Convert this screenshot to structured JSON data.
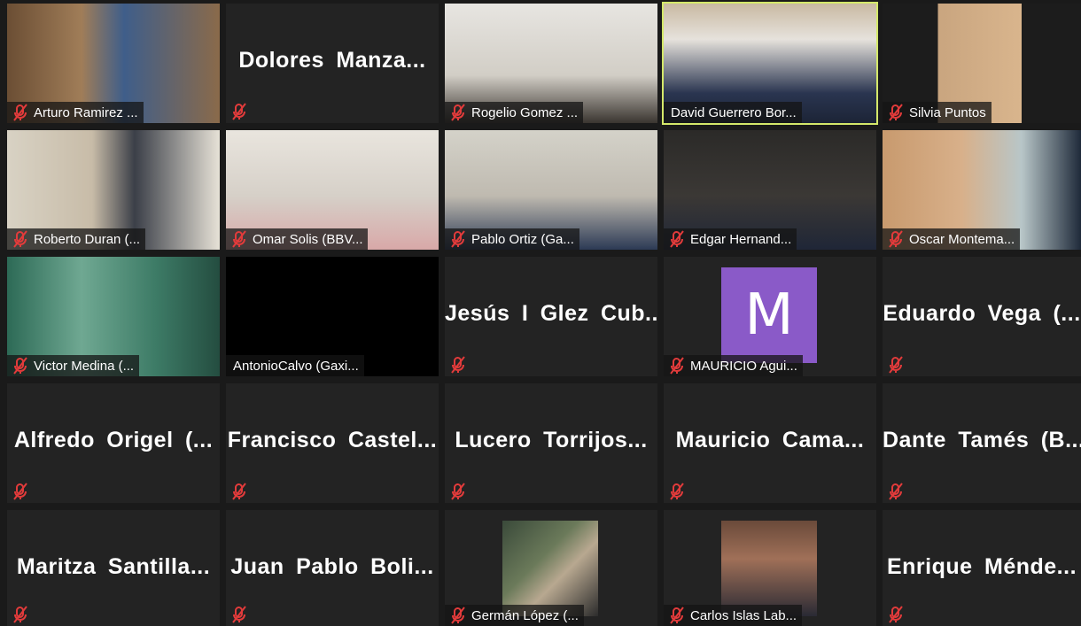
{
  "colors": {
    "mute_icon": "#e23b3b",
    "active_speaker_border": "#d4e86a",
    "avatar_m_bg": "#8a5ac8"
  },
  "participants": [
    {
      "name": "Arturo Ramirez ...",
      "display": "video",
      "muted": true
    },
    {
      "name": "Dolores  Manza...",
      "display": "name",
      "muted": true
    },
    {
      "name": "Rogelio Gomez ...",
      "display": "video",
      "muted": true
    },
    {
      "name": "David Guerrero Bor...",
      "display": "video",
      "muted": false,
      "active": true
    },
    {
      "name": "Silvia Puntos",
      "display": "video",
      "muted": true
    },
    {
      "name": "Roberto Duran (...",
      "display": "video",
      "muted": true
    },
    {
      "name": "Omar Solis (BBV...",
      "display": "video",
      "muted": true
    },
    {
      "name": "Pablo Ortiz  (Ga...",
      "display": "video",
      "muted": true
    },
    {
      "name": "Edgar Hernand...",
      "display": "video",
      "muted": true
    },
    {
      "name": "Oscar Montema...",
      "display": "video",
      "muted": true
    },
    {
      "name": "Victor Medina (...",
      "display": "video",
      "muted": true
    },
    {
      "name": "AntonioCalvo (Gaxi...",
      "display": "video",
      "muted": false
    },
    {
      "name": "Jesús I Glez Cub...",
      "display": "name",
      "muted": true
    },
    {
      "name": "MAURICIO Agui...",
      "display": "avatar",
      "avatar_letter": "M",
      "muted": true
    },
    {
      "name": "Eduardo  Vega  (...",
      "display": "name",
      "muted": true
    },
    {
      "name": "Alfredo  Origel  (...",
      "display": "name",
      "muted": true
    },
    {
      "name": "Francisco  Castel...",
      "display": "name",
      "muted": true
    },
    {
      "name": "Lucero  Torrijos...",
      "display": "name",
      "muted": true
    },
    {
      "name": "Mauricio  Cama...",
      "display": "name",
      "muted": true
    },
    {
      "name": "Dante  Tamés  (B...",
      "display": "name",
      "muted": true
    },
    {
      "name": "Maritza  Santilla...",
      "display": "name",
      "muted": true
    },
    {
      "name": "Juan  Pablo  Boli...",
      "display": "name",
      "muted": true
    },
    {
      "name": "Germán López (...",
      "display": "photo",
      "muted": true
    },
    {
      "name": "Carlos Islas Lab...",
      "display": "photo",
      "muted": true
    },
    {
      "name": "Enrique  Ménde...",
      "display": "name",
      "muted": true
    }
  ]
}
